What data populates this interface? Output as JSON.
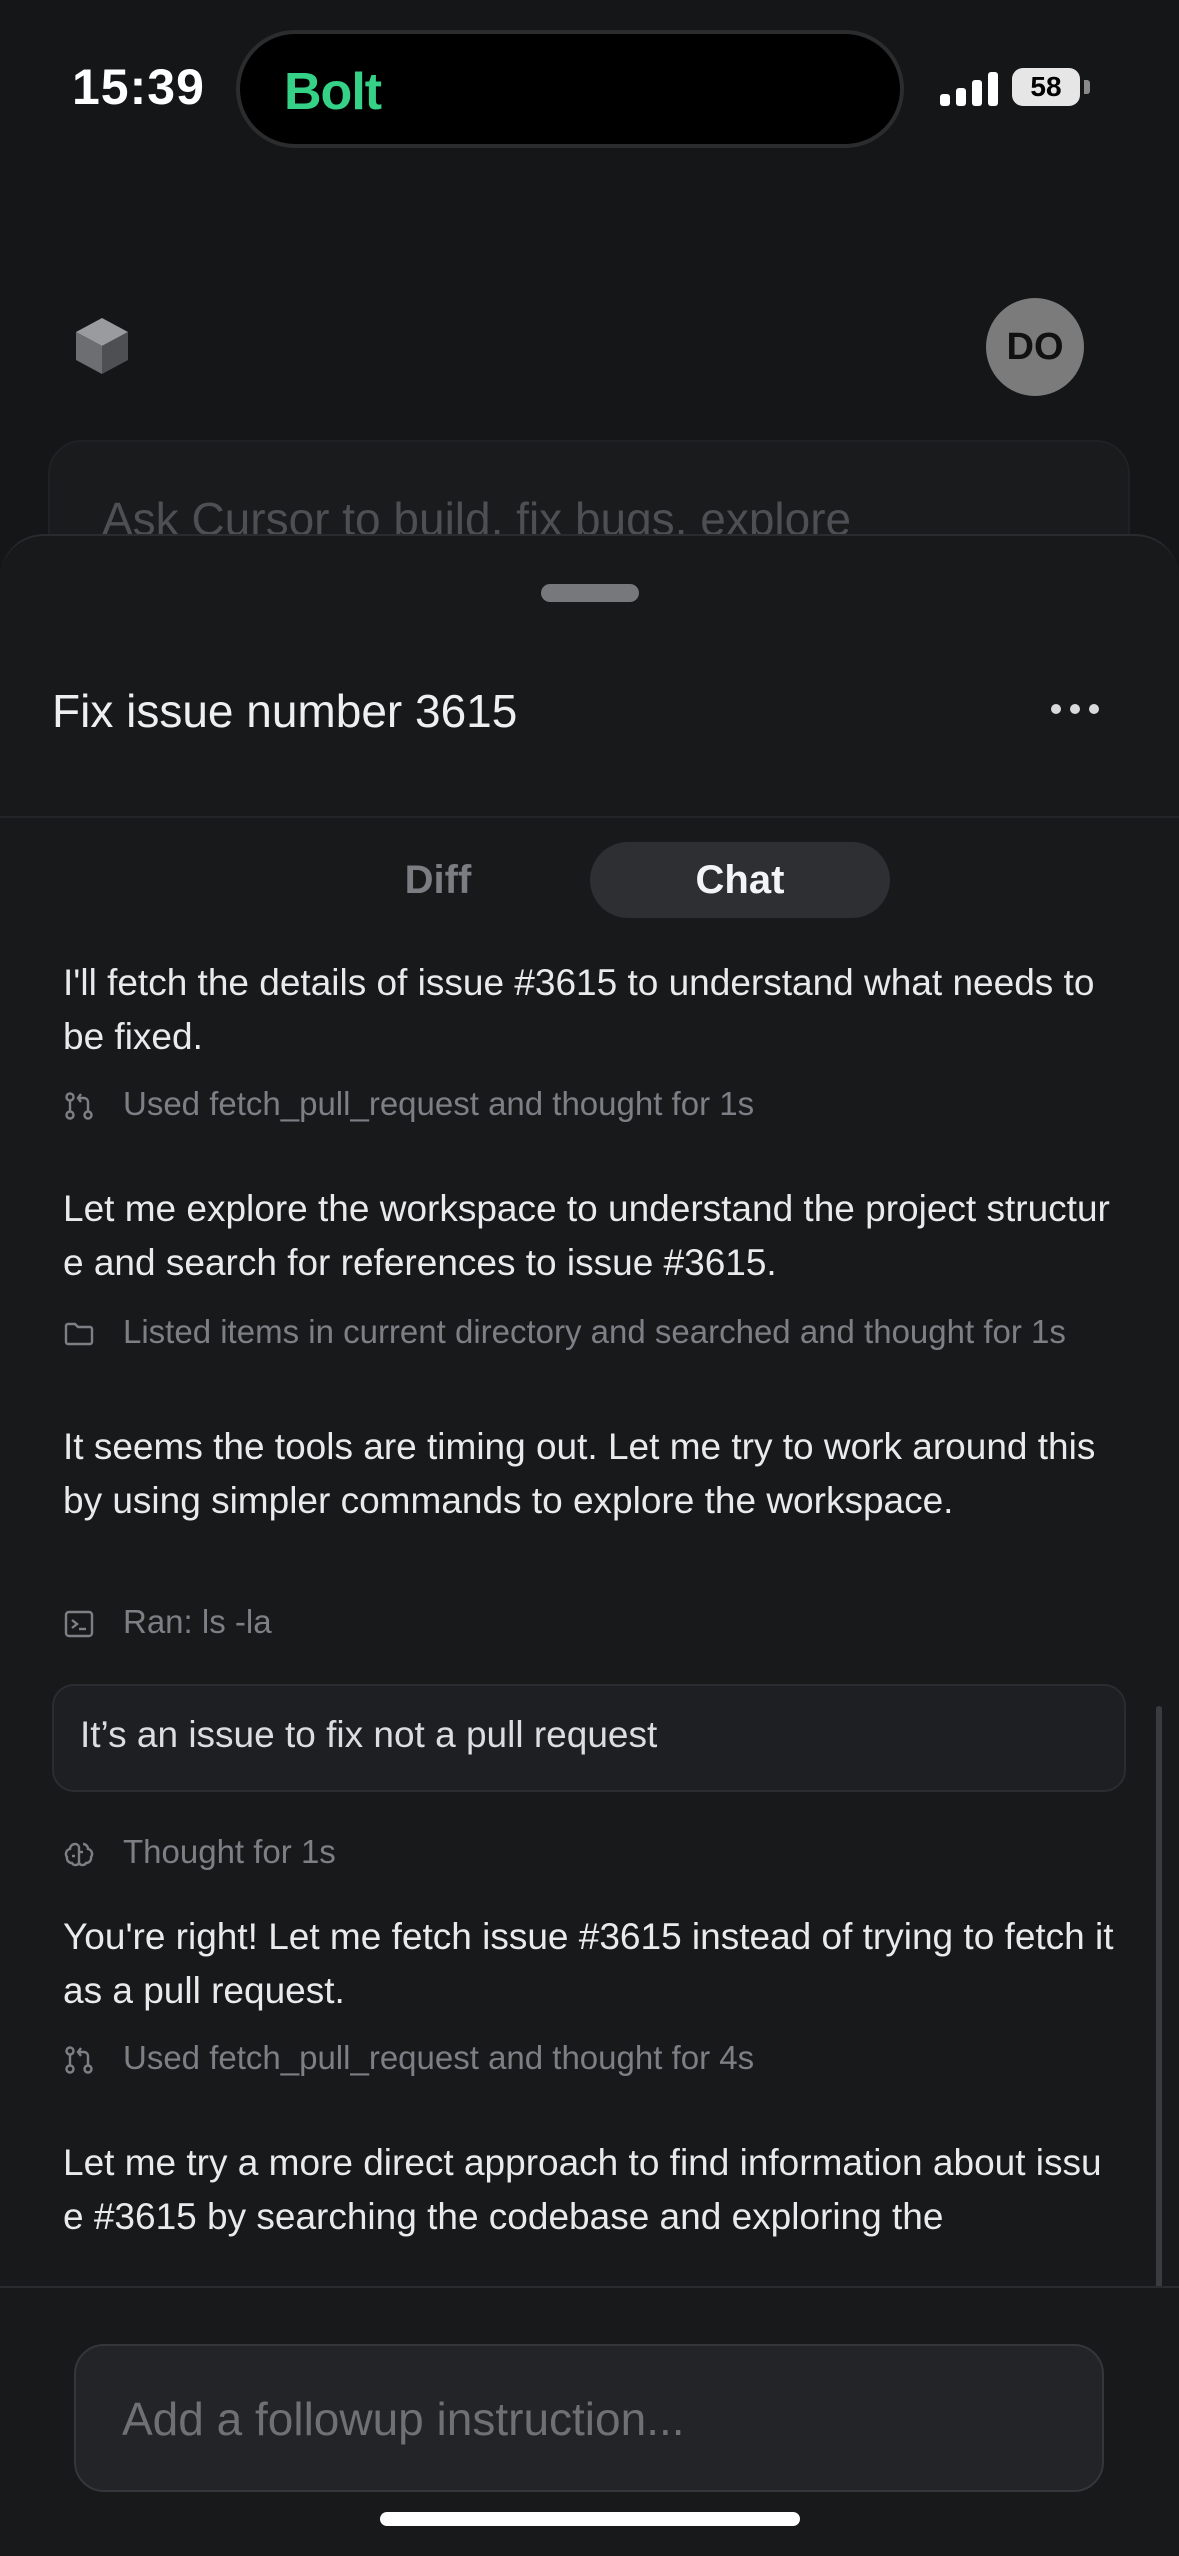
{
  "status_bar": {
    "time": "15:39",
    "island_app": "Bolt",
    "battery": "58"
  },
  "background": {
    "avatar_initials": "DO",
    "prompt_placeholder": "Ask Cursor to build, fix bugs, explore"
  },
  "sheet": {
    "title": "Fix issue number 3615",
    "tabs": [
      {
        "label": "Diff",
        "active": false
      },
      {
        "label": "Chat",
        "active": true
      }
    ]
  },
  "chat": {
    "messages": [
      {
        "kind": "assistant",
        "text": "I'll fetch the details of issue #3615 to understand what needs to be fixed."
      },
      {
        "kind": "tool",
        "icon": "git-pull-request-icon",
        "text": "Used fetch_pull_request and thought for 1s"
      },
      {
        "kind": "assistant",
        "text": "Let me explore the workspace to understand the project structure and search for references to issue #3615."
      },
      {
        "kind": "tool",
        "icon": "folder-icon",
        "text": "Listed items in current directory and searched and thought for 1s"
      },
      {
        "kind": "assistant",
        "text": "It seems the tools are timing out. Let me try to work around this by using simpler commands to explore the workspace."
      },
      {
        "kind": "tool",
        "icon": "terminal-icon",
        "text": "Ran: ls -la"
      },
      {
        "kind": "user",
        "text": "It’s an issue to fix not a pull request"
      },
      {
        "kind": "tool",
        "icon": "brain-icon",
        "text": "Thought for 1s"
      },
      {
        "kind": "assistant",
        "text": "You're right! Let me fetch issue #3615 instead of trying to fetch it as a pull request."
      },
      {
        "kind": "tool",
        "icon": "git-pull-request-icon",
        "text": "Used fetch_pull_request and thought for 4s"
      },
      {
        "kind": "assistant",
        "text": "Let me try a more direct approach to find information about issue #3615 by searching the codebase and exploring the"
      }
    ]
  },
  "followup": {
    "placeholder": "Add a followup instruction..."
  },
  "colors": {
    "background": "#121315",
    "sheet": "#18191b",
    "accent_bolt": "#34d186",
    "muted_text": "#7d7f84"
  }
}
